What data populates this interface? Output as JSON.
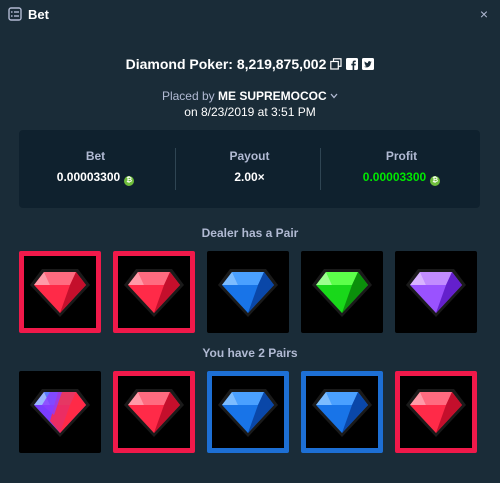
{
  "window": {
    "title": "Bet",
    "close_glyph": "×",
    "icon": "checklist-icon"
  },
  "game": {
    "name_line": "Diamond Poker: 8,219,875,002"
  },
  "placed": {
    "prefix": "Placed by",
    "user": "ME SUPREMOCOC",
    "date": "on 8/23/2019 at 3:51 PM"
  },
  "stats": {
    "bet_label": "Bet",
    "bet_value": "0.00003300",
    "payout_label": "Payout",
    "payout_value": "2.00×",
    "profit_label": "Profit",
    "profit_value": "0.00003300",
    "profit_color": "#00e701",
    "coin_color": "#6fbd3b"
  },
  "dealer": {
    "title": "Dealer has a Pair",
    "cards": [
      {
        "gem": "red",
        "highlight": "red"
      },
      {
        "gem": "red",
        "highlight": "red"
      },
      {
        "gem": "blue",
        "highlight": "none"
      },
      {
        "gem": "green",
        "highlight": "none"
      },
      {
        "gem": "purple",
        "highlight": "none"
      }
    ]
  },
  "player": {
    "title": "You have 2 Pairs",
    "cards": [
      {
        "gem": "multi",
        "highlight": "none"
      },
      {
        "gem": "red",
        "highlight": "red"
      },
      {
        "gem": "blue",
        "highlight": "blue"
      },
      {
        "gem": "blue",
        "highlight": "blue"
      },
      {
        "gem": "red",
        "highlight": "red"
      }
    ]
  },
  "colors": {
    "background": "#1a2c38",
    "panel": "#0f212e",
    "red_highlight": "#f0194a",
    "blue_highlight": "#1d6fd4"
  }
}
